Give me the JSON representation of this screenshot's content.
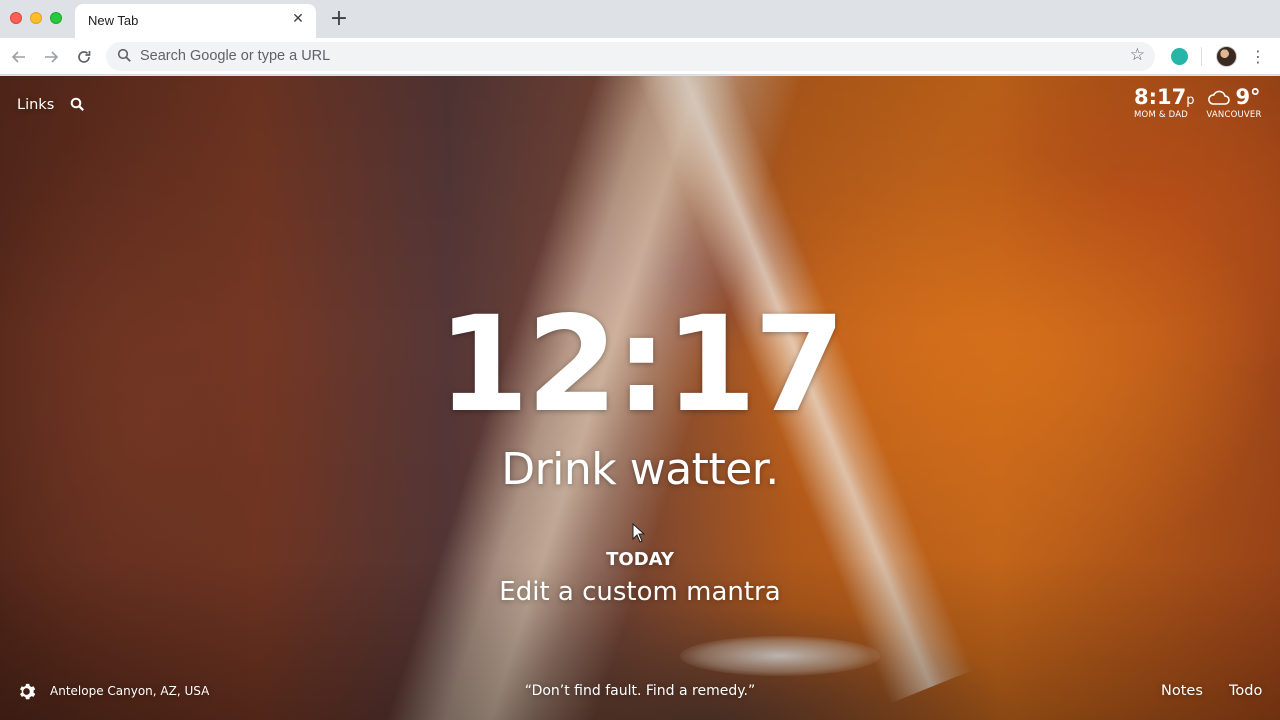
{
  "browser": {
    "tab_title": "New Tab",
    "tab_close": "✕",
    "new_tab": "+",
    "omnibox_placeholder": "Search Google or type a URL",
    "extension_color": "#26b5a7"
  },
  "dashboard": {
    "links_label": "Links",
    "mini_clock": {
      "time": "8:17",
      "meridiem": "p",
      "label": "MOM & DAD"
    },
    "weather": {
      "temp": "9°",
      "location": "VANCOUVER",
      "icon": "cloud-icon"
    },
    "clock": "12:17",
    "greeting": "Drink watter.",
    "focus_heading": "TODAY",
    "focus_text": "Edit a custom mantra",
    "photo_location": "Antelope Canyon, AZ, USA",
    "quote": "“Don’t find fault. Find a remedy.”",
    "notes_label": "Notes",
    "todo_label": "Todo"
  }
}
